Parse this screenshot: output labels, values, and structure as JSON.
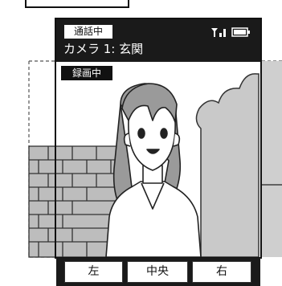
{
  "status": {
    "call_badge": "通話中",
    "camera_label": "カメラ 1: 玄関",
    "recording_badge": "録画中"
  },
  "soft_keys": {
    "left": "左",
    "center": "中央",
    "right": "右"
  },
  "icons": {
    "signal": "signal-strength-icon",
    "battery": "battery-icon"
  }
}
